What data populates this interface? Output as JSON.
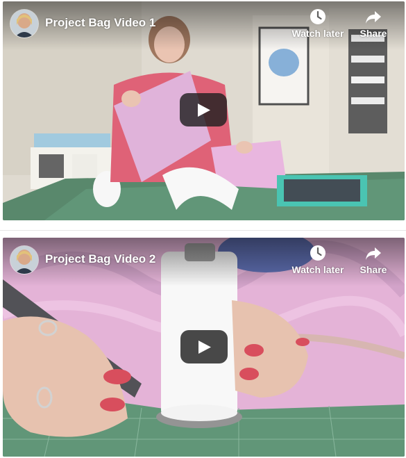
{
  "videos": [
    {
      "title": "Project Bag Video 1",
      "channel_avatar_icon": "presenter-avatar-icon",
      "watch_later_label": "Watch later",
      "share_label": "Share"
    },
    {
      "title": "Project Bag Video 2",
      "channel_avatar_icon": "presenter-avatar-icon",
      "watch_later_label": "Watch later",
      "share_label": "Share"
    }
  ],
  "colors": {
    "play_button_bg": "#212121",
    "overlay_text": "#ffffff",
    "cutting_mat": "#3f7f5b",
    "nail_polish": "#d0283a"
  }
}
